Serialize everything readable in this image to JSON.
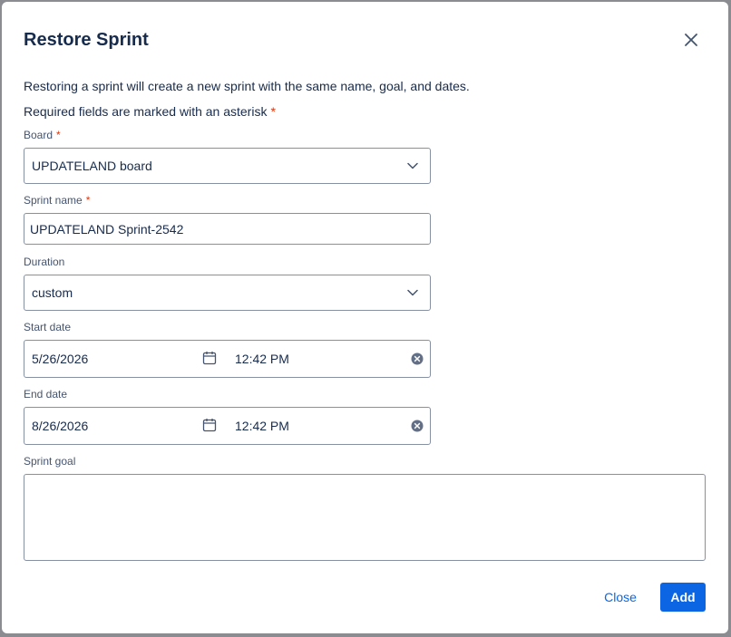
{
  "dialog": {
    "title": "Restore Sprint",
    "description": "Restoring a sprint will create a new sprint with the same name, goal, and dates.",
    "required_note": "Required fields are marked with an asterisk",
    "asterisk": "*"
  },
  "fields": {
    "board": {
      "label": "Board",
      "value": "UPDATELAND board",
      "required": true
    },
    "sprint_name": {
      "label": "Sprint name",
      "value": "UPDATELAND Sprint-2542",
      "required": true
    },
    "duration": {
      "label": "Duration",
      "value": "custom"
    },
    "start_date": {
      "label": "Start date",
      "date": "5/26/2026",
      "time": "12:42 PM"
    },
    "end_date": {
      "label": "End date",
      "date": "8/26/2026",
      "time": "12:42 PM"
    },
    "sprint_goal": {
      "label": "Sprint goal",
      "value": ""
    }
  },
  "buttons": {
    "close": "Close",
    "add": "Add"
  },
  "icons": {
    "close": "close-icon",
    "chevron": "chevron-down-icon",
    "calendar": "calendar-icon",
    "clear": "clear-icon"
  },
  "colors": {
    "primary": "#0c66e4",
    "required": "#de350b",
    "text": "#172b4d"
  }
}
